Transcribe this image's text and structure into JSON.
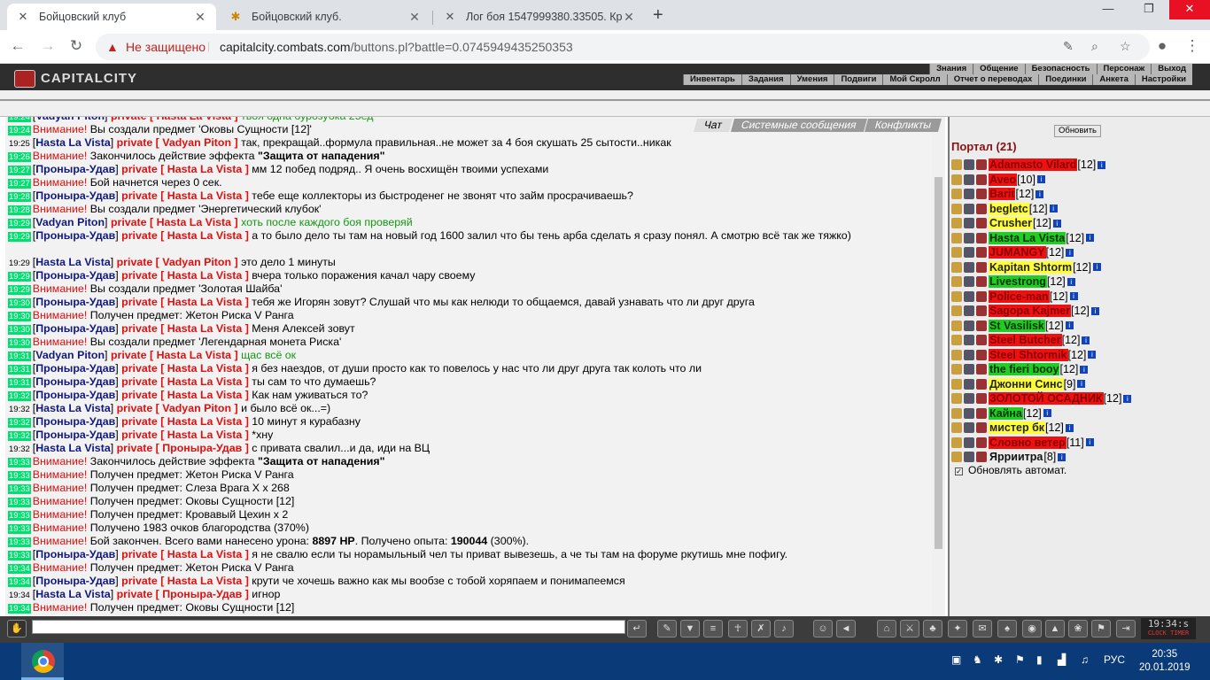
{
  "browser": {
    "tabs": [
      {
        "title": "Бойцовский клуб",
        "active": true
      },
      {
        "title": "Бойцовский клуб.",
        "active": false
      },
      {
        "title": "Лог боя 1547999380.33505. Кро",
        "active": false
      }
    ],
    "insecure_label": "Не защищено",
    "url_host": "capitalcity.combats.com",
    "url_path": "/buttons.pl?battle=0.0745949435250353"
  },
  "game": {
    "logo": "CAPITALCITY",
    "menu_top": [
      "Знания",
      "Общение",
      "Безопасность",
      "Персонаж",
      "Выход"
    ],
    "menu_bottom": [
      "Инвентарь",
      "Задания",
      "Умения",
      "Подвиги",
      "Мой Скролл",
      "Отчет о переводах",
      "Поединки",
      "Анкета",
      "Настройки"
    ]
  },
  "chat_tabs": [
    "Чат",
    "Системные сообщения",
    "Конфликты"
  ],
  "chat": [
    {
      "t": "19:24",
      "g": true,
      "nick": "Vadyan Piton",
      "to": "Hasta La Vista",
      "msg": "твоя одна бурозубка 25ед",
      "green": true
    },
    {
      "t": "19:24",
      "g": true,
      "att": "Внимание!",
      "msg": "Вы создали предмет 'Оковы Сущности [12]'"
    },
    {
      "t": "19:25",
      "g": false,
      "nick": "Hasta La Vista",
      "to": "Vadyan Piton",
      "msg": "так, прекращай..формула правильная..не может за 4 боя скушать 25 сытости..никак"
    },
    {
      "t": "19:26",
      "g": true,
      "att": "Внимание!",
      "msg": "Закончилось действие эффекта ",
      "bold": "\"Защита от нападения\""
    },
    {
      "t": "19:27",
      "g": true,
      "nick": "Проныра-Удав",
      "to": "Hasta La Vista",
      "msg": "мм 12 побед подряд.. Я очень восхищён твоими успехами"
    },
    {
      "t": "19:27",
      "g": true,
      "att": "Внимание!",
      "msg": "Бой начнется через 0 сек."
    },
    {
      "t": "19:28",
      "g": true,
      "nick": "Проныра-Удав",
      "to": "Hasta La Vista",
      "msg": "тебе еще коллекторы из быстроденег не звонят что займ просрачиваешь?"
    },
    {
      "t": "19:28",
      "g": true,
      "att": "Внимание!",
      "msg": "Вы создали предмет 'Энергетический клубок'"
    },
    {
      "t": "19:29",
      "g": true,
      "nick": "Vadyan Piton",
      "to": "Hasta La Vista",
      "msg": "хоть после каждого боя проверяй",
      "green": true
    },
    {
      "t": "19:29",
      "g": true,
      "nick": "Проныра-Удав",
      "to": "Hasta La Vista",
      "msg": "а то было дело ты там на новый год 1600 залил что бы тень арба сделать я сразу понял. А смотрю всё так же тяжко)",
      "wrap": true
    },
    {
      "t": "19:29",
      "g": false,
      "nick": "Hasta La Vista",
      "to": "Vadyan Piton",
      "msg": "это дело 1 минуты"
    },
    {
      "t": "19:29",
      "g": true,
      "nick": "Проныра-Удав",
      "to": "Hasta La Vista",
      "msg": "вчера только поражения качал чару своему"
    },
    {
      "t": "19:29",
      "g": true,
      "att": "Внимание!",
      "msg": "Вы создали предмет 'Золотая Шайба'"
    },
    {
      "t": "19:30",
      "g": true,
      "nick": "Проныра-Удав",
      "to": "Hasta La Vista",
      "msg": "тебя же Игорян зовут? Слушай что мы как нелюди то общаемся, давай узнавать что ли друг друга"
    },
    {
      "t": "19:30",
      "g": true,
      "att": "Внимание!",
      "msg": "Получен предмет: Жетон Риска V Ранга"
    },
    {
      "t": "19:30",
      "g": true,
      "nick": "Проныра-Удав",
      "to": "Hasta La Vista",
      "msg": "Меня Алексей зовут"
    },
    {
      "t": "19:30",
      "g": true,
      "att": "Внимание!",
      "msg": "Вы создали предмет 'Легендарная монета Риска'"
    },
    {
      "t": "19:31",
      "g": true,
      "nick": "Vadyan Piton",
      "to": "Hasta La Vista",
      "msg": "щас всё ок",
      "green": true
    },
    {
      "t": "19:31",
      "g": true,
      "nick": "Проныра-Удав",
      "to": "Hasta La Vista",
      "msg": "я без наездов, от души просто как то повелось у нас что ли друг друга так колоть что ли"
    },
    {
      "t": "19:31",
      "g": true,
      "nick": "Проныра-Удав",
      "to": "Hasta La Vista",
      "msg": "ты сам то что думаешь?"
    },
    {
      "t": "19:32",
      "g": true,
      "nick": "Проныра-Удав",
      "to": "Hasta La Vista",
      "msg": "Как нам уживаться то?"
    },
    {
      "t": "19:32",
      "g": false,
      "nick": "Hasta La Vista",
      "to": "Vadyan Piton",
      "msg": "и было всё ок...=)"
    },
    {
      "t": "19:32",
      "g": true,
      "nick": "Проныра-Удав",
      "to": "Hasta La Vista",
      "msg": "10 минут я курабазну"
    },
    {
      "t": "19:32",
      "g": true,
      "nick": "Проныра-Удав",
      "to": "Hasta La Vista",
      "msg": "*хну"
    },
    {
      "t": "19:32",
      "g": false,
      "nick": "Hasta La Vista",
      "to": "Проныра-Удав",
      "msg": "с привата свалил...и да, иди на ВЦ"
    },
    {
      "t": "19:33",
      "g": true,
      "att": "Внимание!",
      "msg": "Закончилось действие эффекта ",
      "bold": "\"Защита от нападения\""
    },
    {
      "t": "19:33",
      "g": true,
      "att": "Внимание!",
      "msg": "Получен предмет: Жетон Риска V Ранга"
    },
    {
      "t": "19:33",
      "g": true,
      "att": "Внимание!",
      "msg": "Получен предмет: Слеза Врага X x 268"
    },
    {
      "t": "19:33",
      "g": true,
      "att": "Внимание!",
      "msg": "Получен предмет: Оковы Сущности [12]"
    },
    {
      "t": "19:33",
      "g": true,
      "att": "Внимание!",
      "msg": "Получен предмет: Кровавый Цехин x 2"
    },
    {
      "t": "19:33",
      "g": true,
      "att": "Внимание!",
      "msg": "Получено 1983 очков благородства (370%)"
    },
    {
      "t": "19:33",
      "g": true,
      "att": "Внимание!",
      "msg": "Бой закончен. Всего вами нанесено урона: ",
      "b1": "8897 HP",
      "m2": ". Получено опыта: ",
      "b2": "190044",
      "m3": " (300%)."
    },
    {
      "t": "19:33",
      "g": true,
      "nick": "Проныра-Удав",
      "to": "Hasta La Vista",
      "msg": "я не свалю если ты норамыльный чел ты приват вывезешь, а че ты там на форуме ркутишь мне пофигу."
    },
    {
      "t": "19:34",
      "g": true,
      "att": "Внимание!",
      "msg": "Получен предмет: Жетон Риска V Ранга"
    },
    {
      "t": "19:34",
      "g": true,
      "nick": "Проныра-Удав",
      "to": "Hasta La Vista",
      "msg": "крути че хочешь важно как мы вообзе с тобой хоряпаем и понимапеемся"
    },
    {
      "t": "19:34",
      "g": false,
      "nick": "Hasta La Vista",
      "to": "Проныра-Удав",
      "msg": "игнор"
    },
    {
      "t": "19:34",
      "g": true,
      "att": "Внимание!",
      "msg": "Получен предмет: Оковы Сущности [12]"
    }
  ],
  "sidebar": {
    "refresh": "Обновить",
    "portal_title": "Портал (21)",
    "auto_label": "Обновлять автомат.",
    "players": [
      {
        "name": "Adamasto Vilard",
        "lvl": "[12]",
        "bg": "#ee1111",
        "fg": "#880000"
      },
      {
        "name": "Aveo",
        "lvl": "[10]",
        "bg": "#ee1111",
        "fg": "#880000"
      },
      {
        "name": "Barit",
        "lvl": "[12]",
        "bg": "#ee1111",
        "fg": "#880000"
      },
      {
        "name": "begletc",
        "lvl": "[12]",
        "bg": "#ffff33",
        "fg": "#222222"
      },
      {
        "name": "Crusher",
        "lvl": "[12]",
        "bg": "#ffff33",
        "fg": "#222222"
      },
      {
        "name": "Hasta La Vista",
        "lvl": "[12]",
        "bg": "#22cc22",
        "fg": "#003300"
      },
      {
        "name": "JUMANGY",
        "lvl": "[12]",
        "bg": "#ee1111",
        "fg": "#880000"
      },
      {
        "name": "Kapitan Shtorm",
        "lvl": "[12]",
        "bg": "#ffff33",
        "fg": "#222222"
      },
      {
        "name": "Livestrong",
        "lvl": "[12]",
        "bg": "#22cc22",
        "fg": "#003300"
      },
      {
        "name": "Police-man",
        "lvl": "[12]",
        "bg": "#ee1111",
        "fg": "#880000"
      },
      {
        "name": "Sagopa Kajmer",
        "lvl": "[12]",
        "bg": "#ee1111",
        "fg": "#880000"
      },
      {
        "name": "St Vasilisk",
        "lvl": "[12]",
        "bg": "#22cc22",
        "fg": "#003300"
      },
      {
        "name": "Steel Butcher",
        "lvl": "[12]",
        "bg": "#ee1111",
        "fg": "#880000"
      },
      {
        "name": "Steel Shtormik",
        "lvl": "[12]",
        "bg": "#ee1111",
        "fg": "#880000"
      },
      {
        "name": "the fieri booy",
        "lvl": "[12]",
        "bg": "#22cc22",
        "fg": "#003300"
      },
      {
        "name": "Джонни Синс",
        "lvl": "[9]",
        "bg": "#ffff33",
        "fg": "#222222"
      },
      {
        "name": "ЗОЛОТОЙ ОСАДНИК",
        "lvl": "[12]",
        "bg": "#ee1111",
        "fg": "#880000"
      },
      {
        "name": "Кайна",
        "lvl": "[12]",
        "bg": "#22cc22",
        "fg": "#003300"
      },
      {
        "name": "мистер бк",
        "lvl": "[12]",
        "bg": "#ffff33",
        "fg": "#222222"
      },
      {
        "name": "Словно ветер",
        "lvl": "[11]",
        "bg": "#ee1111",
        "fg": "#880000"
      },
      {
        "name": "Ярриитра",
        "lvl": "[8]",
        "bg": "transparent",
        "fg": "#111111"
      }
    ]
  },
  "toolbar": {
    "clock": "19:34:s",
    "clock_sub": "CLOCK TIMER"
  },
  "taskbar": {
    "lang": "РУС",
    "time": "20:35",
    "date": "20.01.2019"
  }
}
